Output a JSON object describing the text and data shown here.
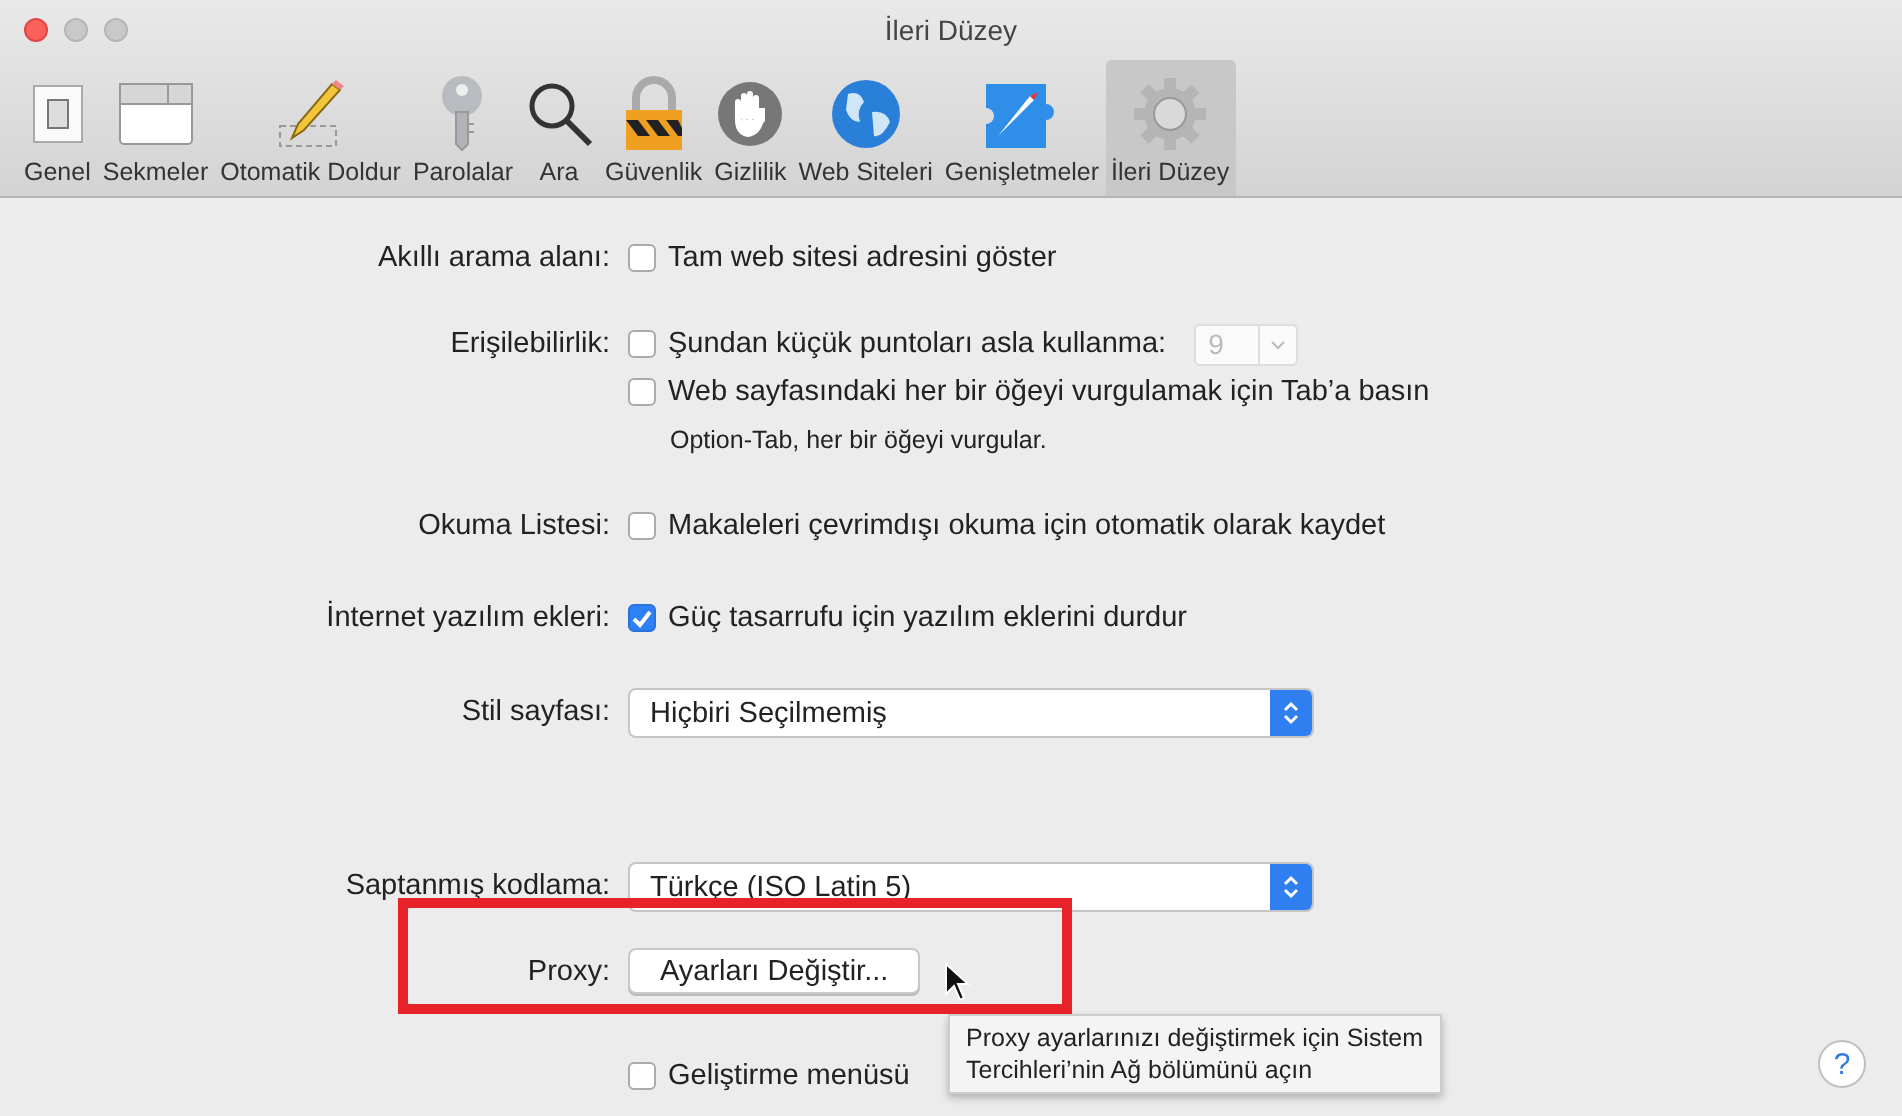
{
  "window": {
    "title": "İleri Düzey"
  },
  "tabs": [
    {
      "label": "Genel",
      "selected": false
    },
    {
      "label": "Sekmeler",
      "selected": false
    },
    {
      "label": "Otomatik Doldur",
      "selected": false
    },
    {
      "label": "Parolalar",
      "selected": false
    },
    {
      "label": "Ara",
      "selected": false
    },
    {
      "label": "Güvenlik",
      "selected": false
    },
    {
      "label": "Gizlilik",
      "selected": false
    },
    {
      "label": "Web Siteleri",
      "selected": false
    },
    {
      "label": "Genişletmeler",
      "selected": false
    },
    {
      "label": "İleri Düzey",
      "selected": true
    }
  ],
  "settings": [
    {
      "kind": "checkboxes",
      "label": "Akıllı arama alanı:",
      "options": [
        {
          "text": "Tam web sitesi adresini göster",
          "checked": false
        }
      ]
    },
    {
      "kind": "checkboxes",
      "label": "Erişilebilirlik:",
      "options": [
        {
          "text": "Şundan küçük puntoları asla kullanma:",
          "checked": false,
          "popup": {
            "value": "9",
            "disabled": true
          }
        },
        {
          "text": "Web sayfasındaki her bir öğeyi vurgulamak için Tab’a basın",
          "checked": false
        }
      ],
      "note": "Option-Tab, her bir öğeyi vurgular."
    },
    {
      "kind": "checkboxes",
      "label": "Okuma Listesi:",
      "options": [
        {
          "text": "Makaleleri çevrimdışı okuma için otomatik olarak kaydet",
          "checked": false
        }
      ]
    },
    {
      "kind": "checkboxes",
      "label": "İnternet yazılım ekleri:",
      "options": [
        {
          "text": "Güç tasarrufu için yazılım eklerini durdur",
          "checked": true
        }
      ]
    },
    {
      "kind": "popup",
      "label": "Stil sayfası:",
      "value": "Hiçbiri Seçilmemiş"
    },
    {
      "kind": "popup",
      "label": "Saptanmış kodlama:",
      "value": "Türkçe (ISO Latin 5)"
    },
    {
      "kind": "button",
      "label": "Proxy:",
      "button": "Ayarları Değiştir..."
    },
    {
      "kind": "checkboxes",
      "options": [
        {
          "text": "Geliştirme menüsü",
          "checked": false
        }
      ]
    }
  ],
  "tooltip": {
    "text": "Proxy ayarlarınızı değiştirmek için Sistem\nTercihleri’nin Ağ bölümünü açın"
  },
  "help_button": {
    "label": "?"
  }
}
